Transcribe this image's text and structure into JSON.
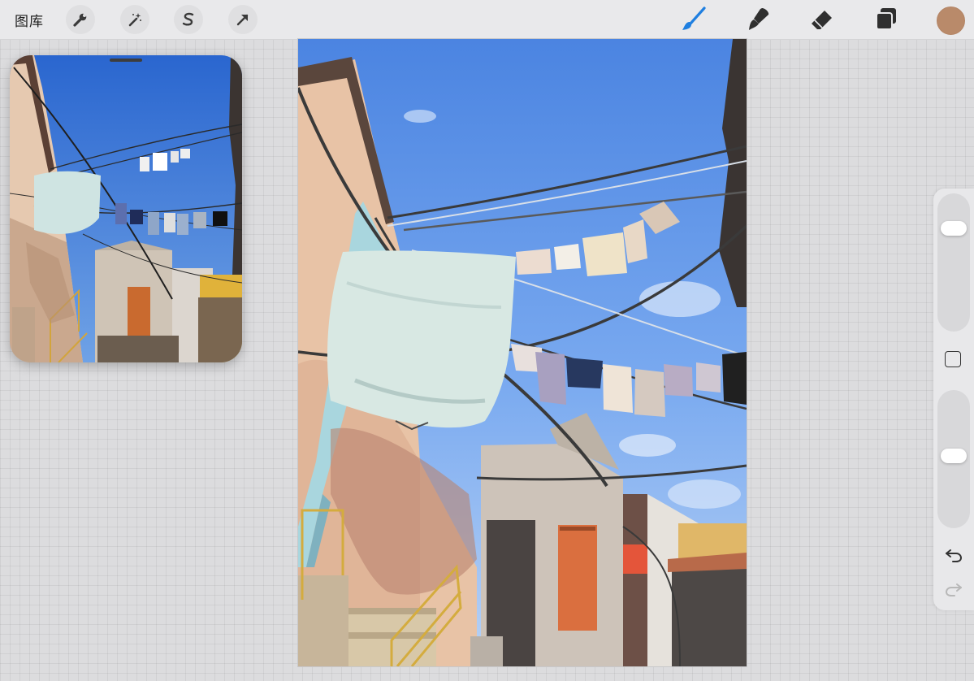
{
  "toolbar": {
    "gallery_label": "图库",
    "left_buttons": [
      "wrench-icon",
      "magic-wand-icon",
      "selection-s-icon",
      "transform-arrow-icon"
    ],
    "right_tools": [
      "brush-icon",
      "smudge-icon",
      "eraser-icon",
      "layers-icon"
    ],
    "active_tool": "brush-icon",
    "accent_color": "#1f7fe0",
    "current_color": "#b98a6a"
  },
  "sidebar": {
    "brush_size_level": 0.8,
    "opacity_level": 0.53,
    "undo_icon": "undo-icon",
    "redo_icon": "redo-icon"
  },
  "colors": {
    "sky_top": "#4d86e2",
    "sky_bottom": "#a7c7f2",
    "wall_peach": "#e9c0a2",
    "sheet_mint": "#d9e8e2",
    "door_orange": "#d9703f",
    "reference_sky": "#2f6fd6"
  }
}
